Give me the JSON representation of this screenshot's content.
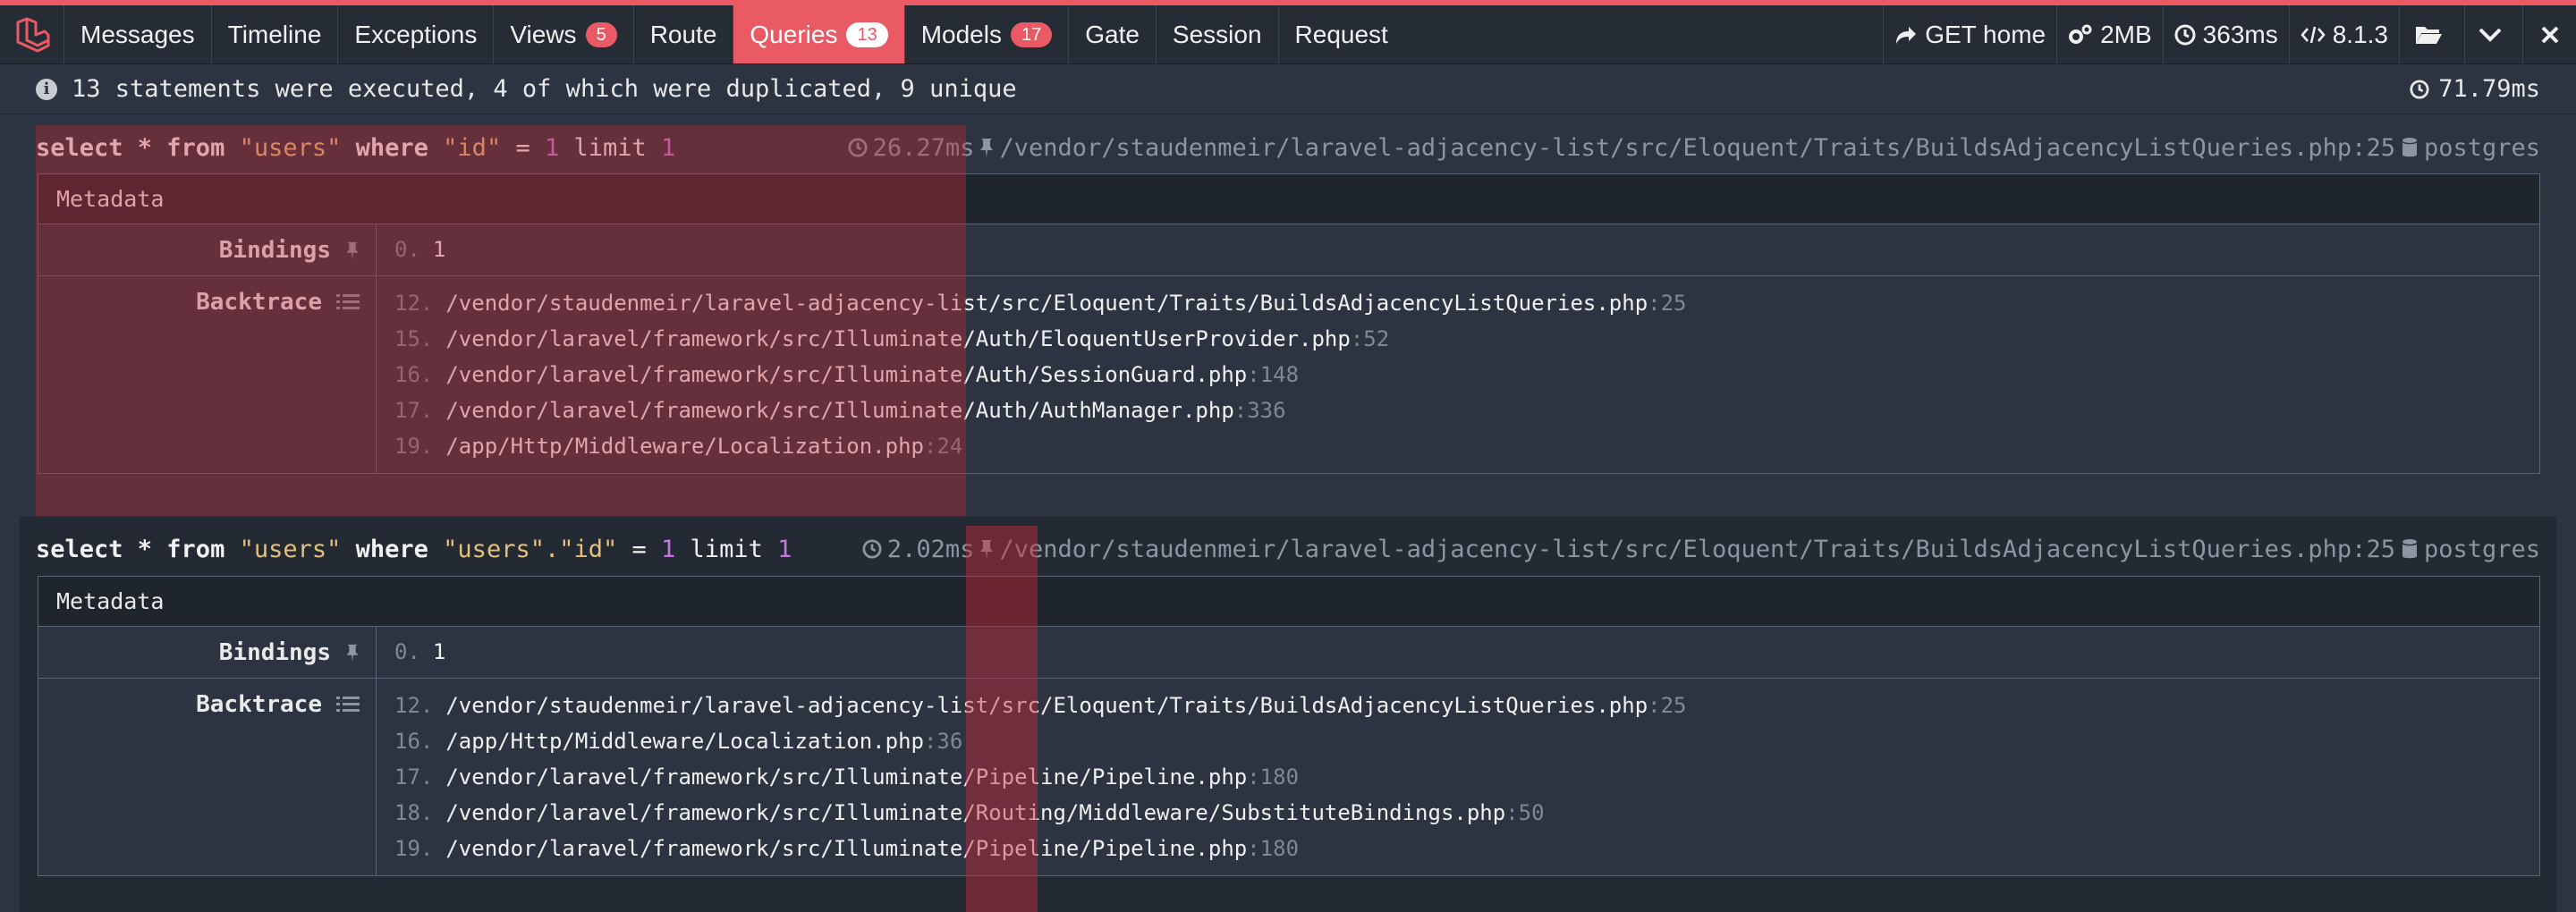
{
  "tabs": [
    {
      "label": "Messages"
    },
    {
      "label": "Timeline"
    },
    {
      "label": "Exceptions"
    },
    {
      "label": "Views",
      "badge": "5"
    },
    {
      "label": "Route"
    },
    {
      "label": "Queries",
      "badge": "13",
      "active": true
    },
    {
      "label": "Models",
      "badge": "17"
    },
    {
      "label": "Gate"
    },
    {
      "label": "Session"
    },
    {
      "label": "Request"
    }
  ],
  "right": {
    "route": "GET home",
    "memory": "2MB",
    "time": "363ms",
    "version": "8.1.3"
  },
  "status": {
    "summary": "13 statements were executed, 4 of which were duplicated, 9 unique",
    "total_time": "71.79ms"
  },
  "statements": [
    {
      "sql": {
        "p1": "select * from ",
        "s1": "\"users\"",
        "p2": " where ",
        "s2": "\"id\"",
        "p3": " = ",
        "n1": "1",
        "p4": " limit ",
        "n2": "1"
      },
      "duration": "26.27ms",
      "source": "/vendor/staudenmeir/laravel-adjacency-list/src/Eloquent/Traits/BuildsAdjacencyListQueries.php:25",
      "connection": "postgres",
      "metadata_label": "Metadata",
      "bindings_label": "Bindings",
      "bindings": [
        {
          "idx": "0.",
          "value": "1"
        }
      ],
      "backtrace_label": "Backtrace",
      "backtrace": [
        {
          "idx": "12.",
          "path": "/vendor/staudenmeir/laravel-adjacency-list/src/Eloquent/Traits/BuildsAdjacencyListQueries.php",
          "line": ":25"
        },
        {
          "idx": "15.",
          "path": "/vendor/laravel/framework/src/Illuminate/Auth/EloquentUserProvider.php",
          "line": ":52"
        },
        {
          "idx": "16.",
          "path": "/vendor/laravel/framework/src/Illuminate/Auth/SessionGuard.php",
          "line": ":148"
        },
        {
          "idx": "17.",
          "path": "/vendor/laravel/framework/src/Illuminate/Auth/AuthManager.php",
          "line": ":336"
        },
        {
          "idx": "19.",
          "path": "/app/Http/Middleware/Localization.php",
          "line": ":24"
        }
      ]
    },
    {
      "sql": {
        "p1": "select * from ",
        "s1": "\"users\"",
        "p2": " where ",
        "s2": "\"users\".",
        "s3": "\"id\"",
        "p3": " = ",
        "n1": "1",
        "p4": " limit ",
        "n2": "1"
      },
      "duration": "2.02ms",
      "source": "/vendor/staudenmeir/laravel-adjacency-list/src/Eloquent/Traits/BuildsAdjacencyListQueries.php:25",
      "connection": "postgres",
      "metadata_label": "Metadata",
      "bindings_label": "Bindings",
      "bindings": [
        {
          "idx": "0.",
          "value": "1"
        }
      ],
      "backtrace_label": "Backtrace",
      "backtrace": [
        {
          "idx": "12.",
          "path": "/vendor/staudenmeir/laravel-adjacency-list/src/Eloquent/Traits/BuildsAdjacencyListQueries.php",
          "line": ":25"
        },
        {
          "idx": "16.",
          "path": "/app/Http/Middleware/Localization.php",
          "line": ":36"
        },
        {
          "idx": "17.",
          "path": "/vendor/laravel/framework/src/Illuminate/Pipeline/Pipeline.php",
          "line": ":180"
        },
        {
          "idx": "18.",
          "path": "/vendor/laravel/framework/src/Illuminate/Routing/Middleware/SubstituteBindings.php",
          "line": ":50"
        },
        {
          "idx": "19.",
          "path": "/vendor/laravel/framework/src/Illuminate/Pipeline/Pipeline.php",
          "line": ":180"
        }
      ]
    }
  ],
  "colors": {
    "accent": "#ea5a64",
    "bg": "#2b3440",
    "string": "#e5c07b",
    "number": "#c678dd"
  }
}
